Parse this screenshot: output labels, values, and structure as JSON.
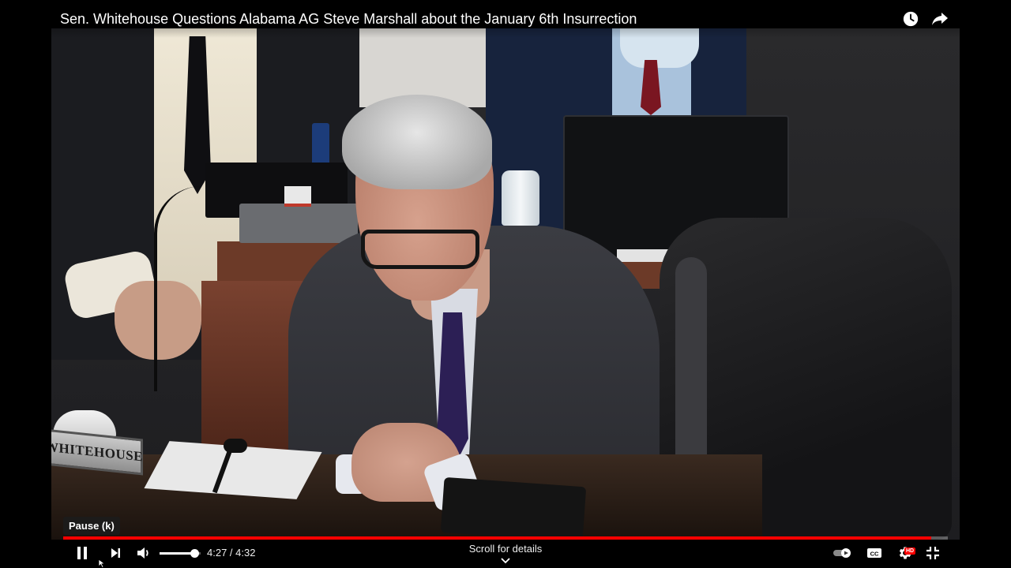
{
  "video": {
    "title": "Sen. Whitehouse Questions Alabama AG Steve Marshall about the January 6th Insurrection",
    "nameplate_text": "WHITEHOUSE"
  },
  "top_actions": {
    "watch_later_icon": "clock-icon",
    "share_icon": "share-arrow-icon"
  },
  "tooltip": {
    "text": "Pause (k)"
  },
  "progress": {
    "played_fraction": 0.981,
    "played_color": "#ff0000"
  },
  "controls": {
    "pause_icon": "pause-icon",
    "next_icon": "next-icon",
    "volume_icon": "volume-icon",
    "volume_level": 0.85,
    "current_time": "4:27",
    "duration": "4:32",
    "time_separator": " / ",
    "scroll_hint": "Scroll for details",
    "autoplay_icon": "autoplay-toggle-icon",
    "cc_icon": "closed-captions-icon",
    "settings_icon": "gear-icon",
    "hd_badge": "HD",
    "exit_fullscreen_icon": "exit-fullscreen-icon"
  }
}
